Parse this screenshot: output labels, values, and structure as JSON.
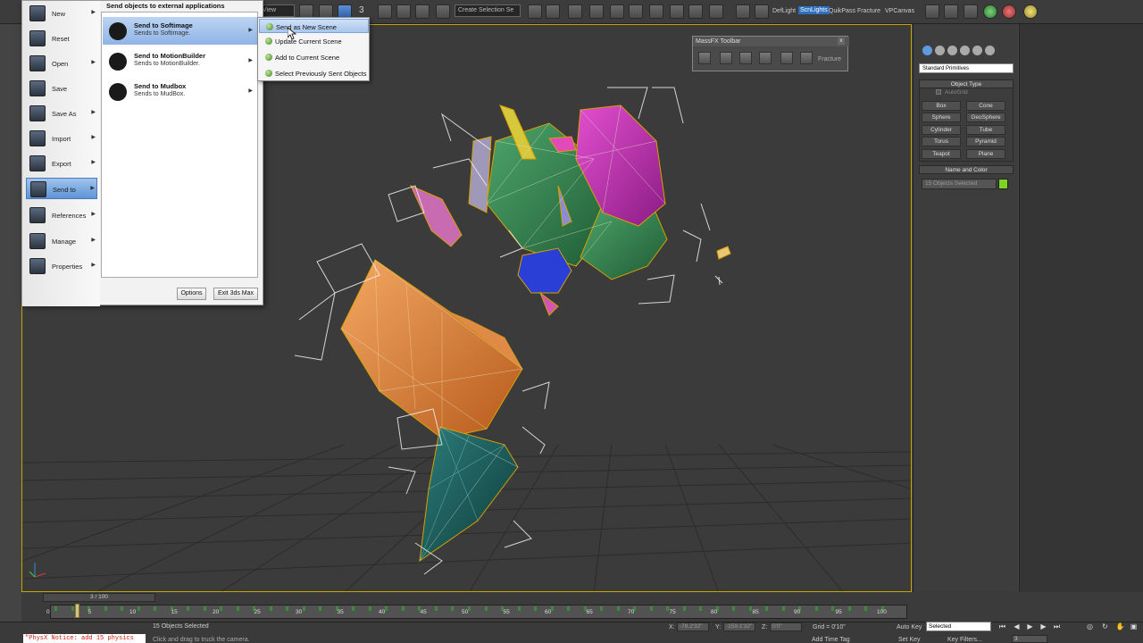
{
  "toolbar": {
    "view_combo": "View",
    "selection_set": "Create Selection Se",
    "snap_label": "3",
    "render_buttons": [
      "DefLight",
      "ScnLights",
      "QuikPass",
      "Fracture",
      "VPCanvas"
    ]
  },
  "massfx": {
    "title": "MassFX Toolbar",
    "close_glyph": "x",
    "fracture_label": "Fracture"
  },
  "app_menu": {
    "header": "Send objects to external applications",
    "items": [
      {
        "label": "New",
        "icon": "new-doc-icon",
        "has_arrow": true
      },
      {
        "label": "Reset",
        "icon": "reset-icon",
        "has_arrow": false
      },
      {
        "label": "Open",
        "icon": "open-folder-icon",
        "has_arrow": true
      },
      {
        "label": "Save",
        "icon": "save-disk-icon",
        "has_arrow": false
      },
      {
        "label": "Save As",
        "icon": "save-as-icon",
        "has_arrow": true
      },
      {
        "label": "Import",
        "icon": "import-icon",
        "has_arrow": true
      },
      {
        "label": "Export",
        "icon": "export-icon",
        "has_arrow": true
      },
      {
        "label": "Send to",
        "icon": "send-to-icon",
        "has_arrow": true,
        "selected": true
      },
      {
        "label": "References",
        "icon": "references-icon",
        "has_arrow": true
      },
      {
        "label": "Manage",
        "icon": "manage-icon",
        "has_arrow": true
      },
      {
        "label": "Properties",
        "icon": "properties-icon",
        "has_arrow": true
      }
    ],
    "send_to": [
      {
        "title": "Send to Softimage",
        "desc": "Sends to Softimage.",
        "icon": "softimage-icon",
        "selected": true
      },
      {
        "title": "Send to MotionBuilder",
        "desc": "Sends to MotionBuilder.",
        "icon": "motionbuilder-icon"
      },
      {
        "title": "Send to Mudbox",
        "desc": "Sends to MudBox.",
        "icon": "mudbox-icon"
      }
    ],
    "options_label": "Options",
    "exit_label": "Exit 3ds Max"
  },
  "flyout": {
    "items": [
      {
        "label": "Send as New Scene",
        "selected": true
      },
      {
        "label": "Update Current Scene"
      },
      {
        "label": "Add to Current Scene"
      },
      {
        "label": "Select Previously Sent Objects"
      }
    ]
  },
  "command_panel": {
    "primitive_type": "Standard Primitives",
    "object_type_title": "Object Type",
    "autogrid_label": "AutoGrid",
    "buttons": [
      "Box",
      "Cone",
      "Sphere",
      "GeoSphere",
      "Cylinder",
      "Tube",
      "Torus",
      "Pyramid",
      "Teapot",
      "Plane"
    ],
    "name_color_title": "Name and Color",
    "name_value": "15 Objects Selected",
    "object_color": "#7ed320"
  },
  "timeline": {
    "slider_label": "3 / 100",
    "current_frame": 3,
    "total_frames": 100,
    "ticks": [
      "0",
      "5",
      "10",
      "15",
      "20",
      "25",
      "30",
      "35",
      "40",
      "45",
      "50",
      "55",
      "60",
      "65",
      "70",
      "75",
      "80",
      "85",
      "90",
      "95",
      "100"
    ]
  },
  "status": {
    "maxscript": "\"PhysX Notice: add 15 physics",
    "selection": "15 Objects Selected",
    "prompt": "Click and drag to truck the camera.",
    "x_label": "X:",
    "x_value": "-78.2'32\"",
    "y_label": "Y:",
    "y_value": "-159.1'32\"",
    "z_label": "Z:",
    "z_value": "0'0\"",
    "grid": "Grid = 0'10\"",
    "autokey": "Auto Key",
    "setkey": "Set Key",
    "key_mode": "Selected",
    "key_filters": "Key Filters...",
    "frame": "3",
    "add_time_tag": "Add Time Tag"
  }
}
